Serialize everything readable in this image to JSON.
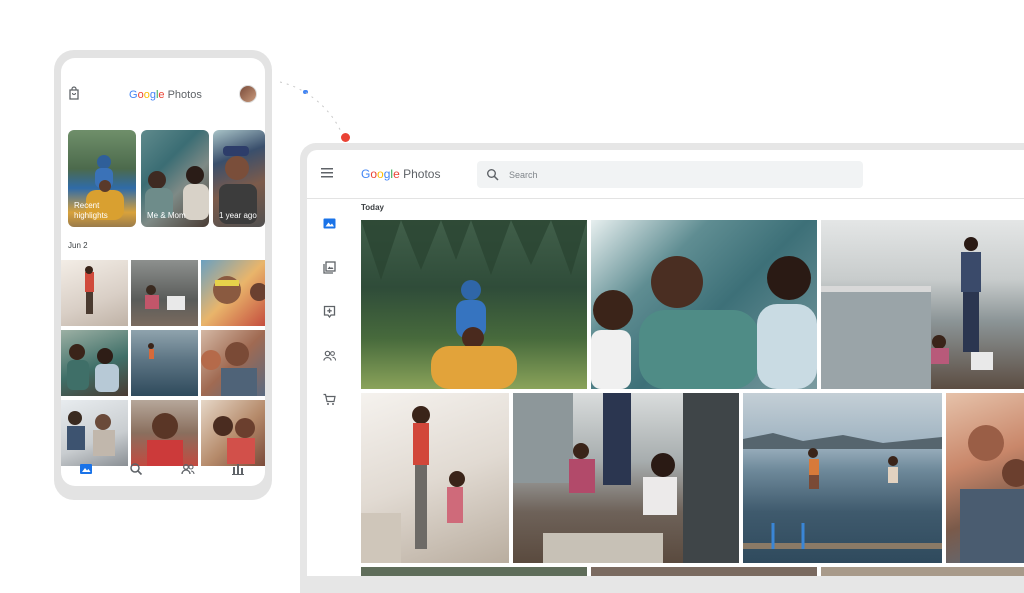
{
  "phone": {
    "app_name_google": "Google",
    "app_name_photos": "Photos",
    "memories": [
      {
        "label": "Recent highlights"
      },
      {
        "label": "Me & Mom"
      },
      {
        "label": "1 year ago"
      }
    ],
    "date_heading": "Jun 2",
    "icons": {
      "top_left": "shopping-bag-icon",
      "avatar": "avatar",
      "nav": [
        "photos-icon",
        "search-icon",
        "sharing-icon",
        "library-icon"
      ]
    },
    "active_nav_color": "#1a73e8"
  },
  "desktop": {
    "app_name_google": "Google",
    "app_name_photos": "Photos",
    "search": {
      "placeholder": "Search",
      "value": ""
    },
    "section_heading": "Today",
    "sidebar_icons": [
      "photos-icon",
      "albums-icon",
      "assistant-icon",
      "sharing-icon",
      "print-store-icon"
    ]
  },
  "colors": {
    "accent_blue": "#1a73e8",
    "google_blue": "#4285F4",
    "google_red": "#EA4335",
    "google_yellow": "#FBBC05",
    "google_green": "#34A853",
    "frame_gray": "#e3e3e3"
  }
}
